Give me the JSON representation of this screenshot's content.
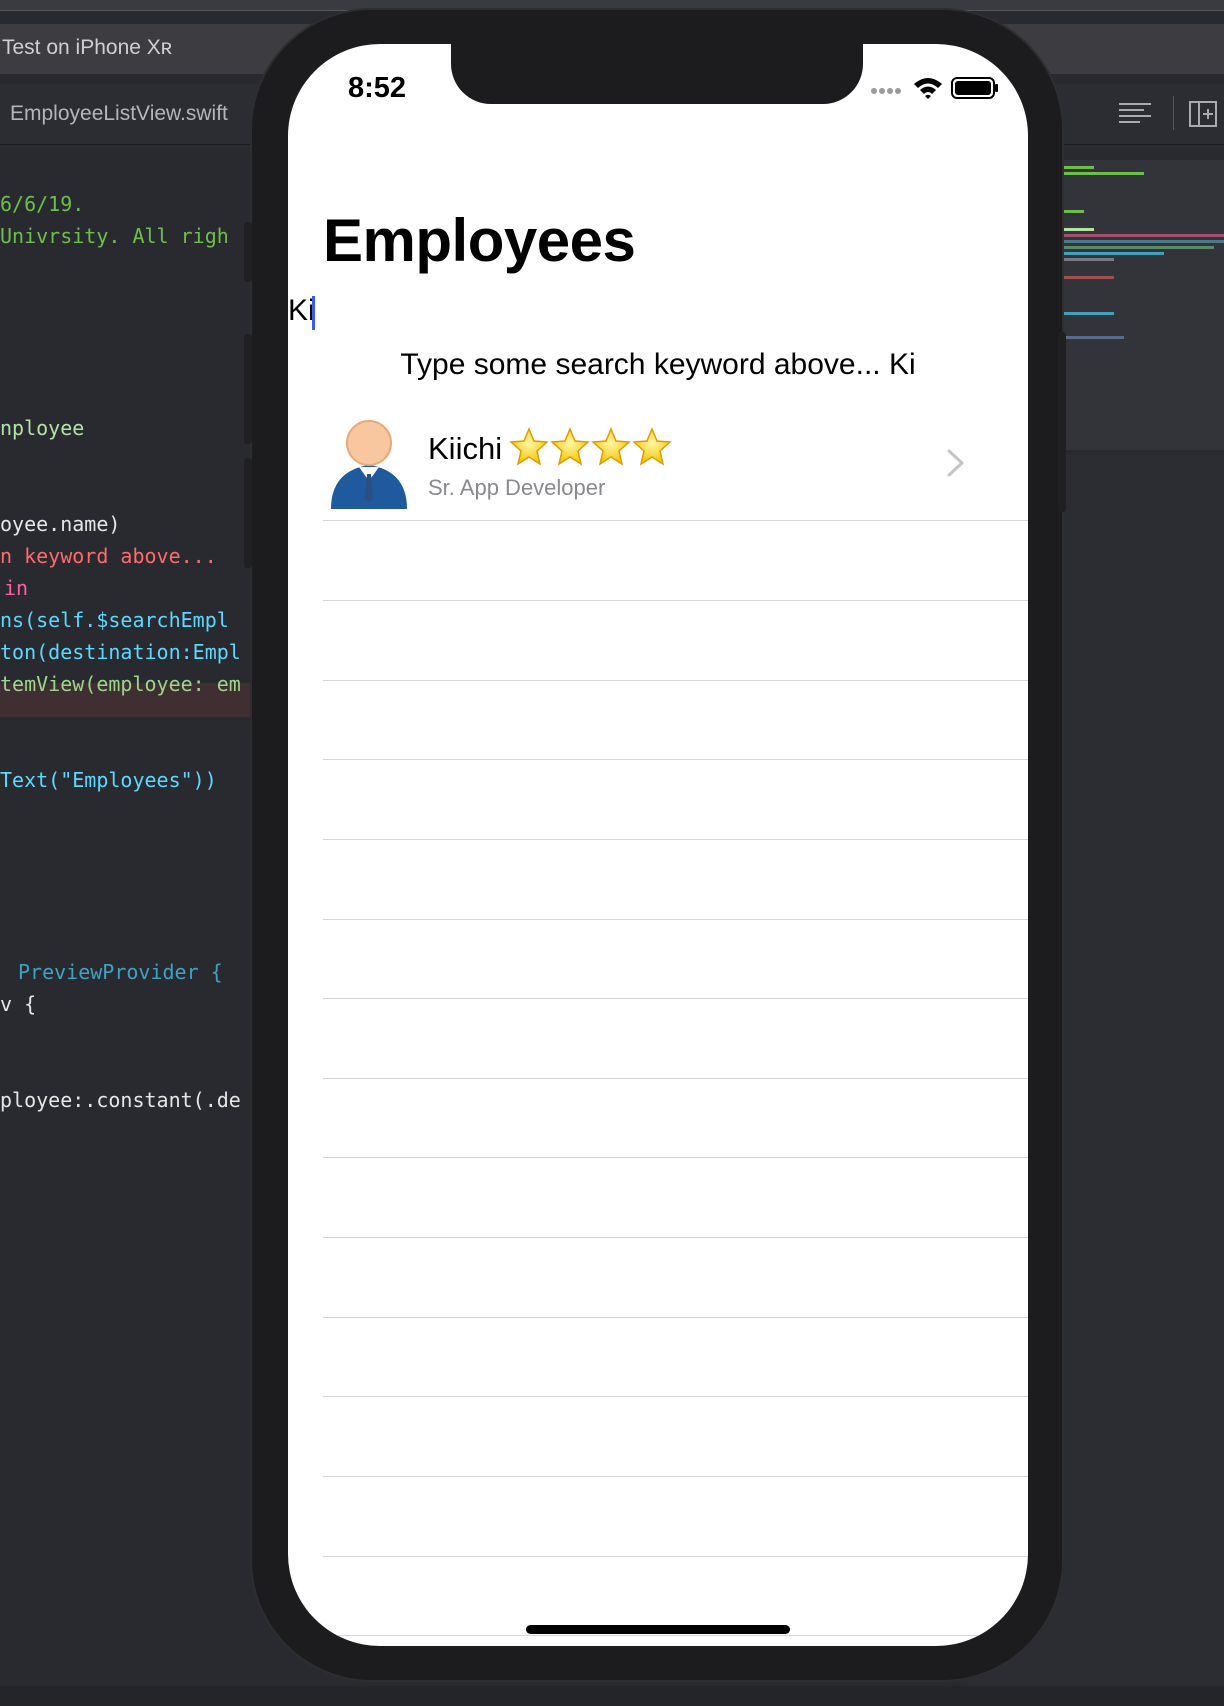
{
  "xcode": {
    "scheme": "Test on iPhone Xʀ",
    "tab": "EmployeeListView.swift",
    "code": [
      "6/6/19.",
      "Univrsity. All righ",
      "nployee",
      "oyee.name)",
      "n keyword above...",
      "in",
      "ns(self.$searchEmpl",
      "ton(destination:Empl",
      "temView(employee: em",
      "Text(\"Employees\"))",
      "PreviewProvider {",
      "v {",
      "ployee:.constant(.de"
    ]
  },
  "status_bar": {
    "time": "8:52"
  },
  "nav": {
    "title": "Employees"
  },
  "search": {
    "value": "Ki"
  },
  "hint": "Type some search keyword above... Ki",
  "employees": [
    {
      "name": "Kiichi",
      "rating": 4,
      "title": "Sr. App Developer"
    }
  ],
  "colors": {
    "accent": "#3d5af1",
    "star": "#f5c400",
    "avatar_suit": "#1f5a9e",
    "avatar_skin": "#f8c7a0"
  },
  "icons": [
    "signal-dots-icon",
    "wifi-icon",
    "battery-icon",
    "star-icon",
    "chevron-right-icon",
    "person-avatar-icon"
  ]
}
